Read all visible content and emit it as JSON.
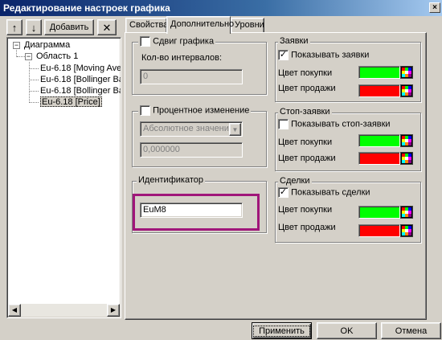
{
  "window": {
    "title": "Редактирование настроек графика",
    "close_glyph": "×"
  },
  "toolbar": {
    "up_icon": "arrow-up-icon",
    "down_icon": "arrow-down-icon",
    "add_label": "Добавить",
    "delete_icon": "close-icon",
    "up_glyph": "↑",
    "down_glyph": "↓",
    "delete_glyph": "✕"
  },
  "tree": {
    "root": "Диаграмма",
    "area": "Область 1",
    "items": [
      "Eu-6.18 [Moving Ave",
      "Eu-6.18 [Bollinger Ba",
      "Eu-6.18 [Bollinger Ba",
      "Eu-6.18 [Price]"
    ],
    "selected_index": 3,
    "expand_glyph": "−"
  },
  "tabs": [
    "Свойства",
    "Дополнительно",
    "Уровни"
  ],
  "active_tab": 1,
  "shift": {
    "checkbox_label": "Сдвиг графика",
    "checked": false,
    "intervals_label": "Кол-во интервалов:",
    "intervals_value": "0"
  },
  "percent": {
    "checkbox_label": "Процентное изменение",
    "checked": false,
    "mode_value": "Абсолютное значение",
    "number_value": "0,000000"
  },
  "identifier": {
    "label": "Идентификатор",
    "value": "EuM8"
  },
  "orders": {
    "title": "Заявки",
    "show_label": "Показывать заявки",
    "checked": true,
    "buy_label": "Цвет покупки",
    "sell_label": "Цвет продажи",
    "buy_color": "#00ff00",
    "sell_color": "#ff0000"
  },
  "stop_orders": {
    "title": "Стоп-заявки",
    "show_label": "Показывать стоп-заявки",
    "checked": false,
    "buy_label": "Цвет покупки",
    "sell_label": "Цвет продажи",
    "buy_color": "#00ff00",
    "sell_color": "#ff0000"
  },
  "deals": {
    "title": "Сделки",
    "show_label": "Показывать сделки",
    "checked": true,
    "buy_label": "Цвет покупки",
    "sell_label": "Цвет продажи",
    "buy_color": "#00ff00",
    "sell_color": "#ff0000"
  },
  "check_glyph": "✓",
  "combo_arrow_glyph": "▼",
  "scroll_left_glyph": "◀",
  "scroll_right_glyph": "▶",
  "footer": {
    "apply": "Применить",
    "ok": "OK",
    "cancel": "Отмена"
  },
  "colors": {
    "titlebar": "#0a246a",
    "face": "#d4d0c8",
    "highlight_frame": "#a0167a"
  }
}
